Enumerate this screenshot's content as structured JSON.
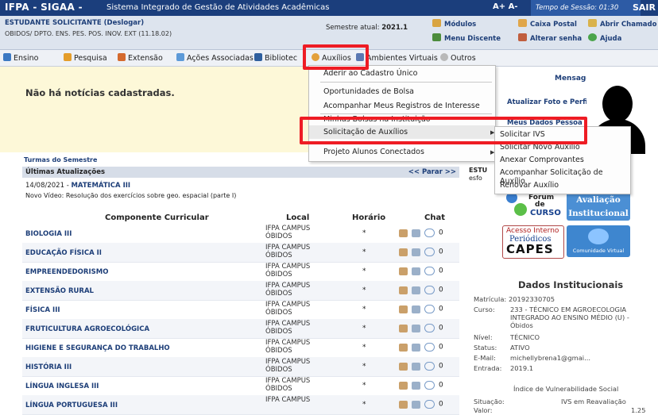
{
  "topbar": {
    "title": "IFPA - SIGAA -",
    "subtitle": "Sistema Integrado de Gestão de Atividades Acadêmicas",
    "font_ctrl": "A+  A-",
    "session": "Tempo de Sessão: 01:30",
    "logout": "SAIR"
  },
  "user": {
    "name": "ESTUDANTE SOLICITANTE",
    "deslogar": "(Deslogar)",
    "dept": "OBIDOS/ DPTO. ENS. PES. POS. INOV. EXT (11.18.02)",
    "semester_label": "Semestre atual:",
    "semester_value": "2021.1"
  },
  "quick_links": {
    "modulos": "Módulos",
    "caixa_postal": "Caixa Postal",
    "abrir_chamado": "Abrir Chamado",
    "menu_discente": "Menu Discente",
    "alterar_senha": "Alterar senha",
    "ajuda": "Ajuda"
  },
  "menu": {
    "ensino": "Ensino",
    "pesquisa": "Pesquisa",
    "extensao": "Extensão",
    "acoes": "Ações Associadas",
    "biblioteca": "Bibliotec",
    "auxilios": "Auxílios",
    "ambientes": "Ambientes Virtuais",
    "outros": "Outros"
  },
  "dropdown": {
    "aderir": "Aderir ao Cadastro Único",
    "oportunidades": "Oportunidades de Bolsa",
    "acompanhar": "Acompanhar Meus Registros de Interesse",
    "minhas": "Minhas Bolsas na Instituição",
    "solicitacao": "Solicitação de Auxílios",
    "projeto": "Projeto Alunos Conectados"
  },
  "submenu": {
    "ivs": "Solicitar IVS",
    "novo": "Solicitar Novo Auxílio",
    "anexar": "Anexar Comprovantes",
    "acompanhar": "Acompanhar Solicitação de Auxílio",
    "renovar": "Renovar Auxílio"
  },
  "notice": "Não há notícias cadastradas.",
  "side": {
    "mensagens": "Mensagens",
    "atualizar_foto": "Atualizar Foto e Perfil",
    "meus_dados": "Meus Dados Pessoa",
    "est": "ESTU",
    "esf": "esfo"
  },
  "turmas_title": "Turmas do Semestre",
  "updates": {
    "title": "Últimas Atualizações",
    "parar": "<< Parar >>",
    "date": "14/08/2021 -",
    "subject": "MATEMÁTICA III",
    "text": "Novo Vídeo: Resolução dos exercícios sobre geo. espacial (parte I)"
  },
  "table": {
    "headers": {
      "componente": "Componente Curricular",
      "local": "Local",
      "horario": "Horário",
      "chat": "Chat"
    },
    "rows": [
      {
        "name": "BIOLOGIA III",
        "local1": "IFPA CAMPUS",
        "local2": "ÓBIDOS",
        "horario": "*",
        "chat": "0"
      },
      {
        "name": "EDUCAÇÃO FÍSICA II",
        "local1": "IFPA CAMPUS",
        "local2": "ÓBIDOS",
        "horario": "*",
        "chat": "0"
      },
      {
        "name": "EMPREENDEDORISMO",
        "local1": "IFPA CAMPUS",
        "local2": "ÓBIDOS",
        "horario": "*",
        "chat": "0"
      },
      {
        "name": "EXTENSÃO RURAL",
        "local1": "IFPA CAMPUS",
        "local2": "ÓBIDOS",
        "horario": "*",
        "chat": "0"
      },
      {
        "name": "FÍSICA III",
        "local1": "IFPA CAMPUS",
        "local2": "ÓBIDOS",
        "horario": "*",
        "chat": "0"
      },
      {
        "name": "FRUTICULTURA AGROECOLÓGICA",
        "local1": "IFPA CAMPUS",
        "local2": "ÓBIDOS",
        "horario": "*",
        "chat": "0"
      },
      {
        "name": "HIGIENE E SEGURANÇA DO TRABALHO",
        "local1": "IFPA CAMPUS",
        "local2": "ÓBIDOS",
        "horario": "*",
        "chat": "0"
      },
      {
        "name": "HISTÓRIA III",
        "local1": "IFPA CAMPUS",
        "local2": "ÓBIDOS",
        "horario": "*",
        "chat": "0"
      },
      {
        "name": "LÍNGUA INGLESA III",
        "local1": "IFPA CAMPUS",
        "local2": "ÓBIDOS",
        "horario": "*",
        "chat": "0"
      },
      {
        "name": "LÍNGUA PORTUGUESA III",
        "local1": "IFPA CAMPUS",
        "local2": "",
        "horario": "*",
        "chat": "0"
      }
    ]
  },
  "logos": {
    "forum1": "Fórum",
    "forum2": "de",
    "forum3": "CURSO",
    "aval1": "Avaliação",
    "aval2": "Institucional",
    "capes1": "Acesso Interno",
    "capes2": "Periódicos",
    "capes3": "CAPES",
    "comunidade": "Comunidade Virtual"
  },
  "dados": {
    "title": "Dados Institucionais",
    "matricula_label": "Matrícula:",
    "matricula": "20192330705",
    "curso_label": "Curso:",
    "curso1": "233 - TÉCNICO EM AGROECOLOGIA",
    "curso2": "INTEGRADO AO ENSINO MÉDIO (U) -",
    "curso3": "Óbidos",
    "nivel_label": "Nível:",
    "nivel": "TÉCNICO",
    "status_label": "Status:",
    "status": "ATIVO",
    "email_label": "E-Mail:",
    "email": "michellybrena1@gmai...",
    "entrada_label": "Entrada:",
    "entrada": "2019.1",
    "ivs_title": "Índice de Vulnerabilidade Social",
    "situacao_label": "Situação:",
    "situacao": "IVS em Reavaliação",
    "valor_label": "Valor:",
    "valor": "1.25"
  }
}
